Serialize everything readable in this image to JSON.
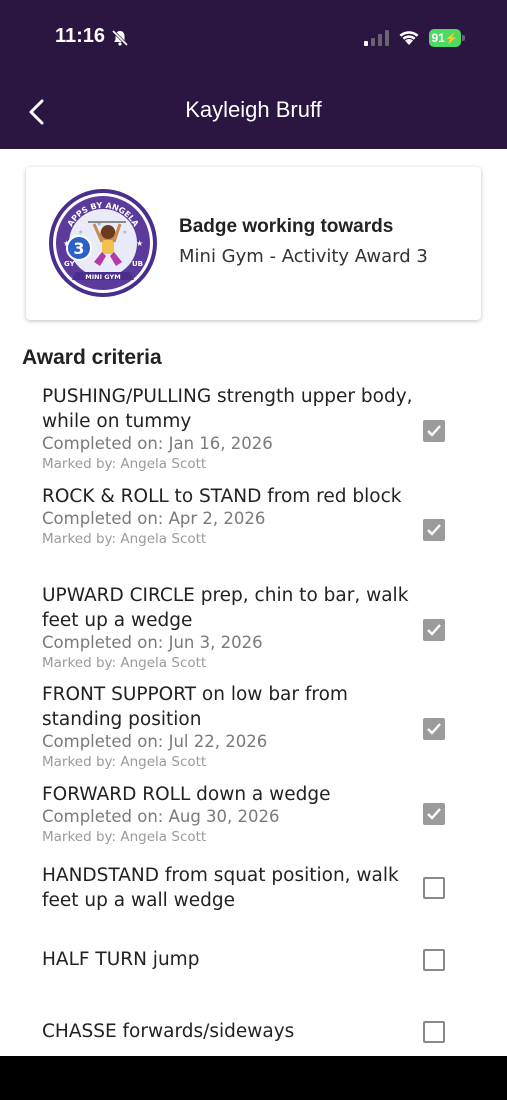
{
  "status": {
    "time": "11:16",
    "battery": "91"
  },
  "nav": {
    "title": "Kayleigh Bruff"
  },
  "badge_card": {
    "title": "Badge working towards",
    "subtitle": "Mini Gym - Activity Award 3",
    "logo": {
      "top_text": "APPS BY ANGELA",
      "bottom_text": "MINI GYM",
      "left_text": "GY",
      "right_text": "UB",
      "number": "3",
      "colors": {
        "ring": "#5b3a9c",
        "inner": "#e9ecf8",
        "ribbon": "#4a2d8c"
      }
    }
  },
  "criteria": {
    "heading": "Award criteria",
    "items": [
      {
        "title": "PUSHING/PULLING strength upper body, while on tummy",
        "completed": "Completed on: Jan 16, 2026",
        "marked": "Marked by: Angela Scott",
        "checked": true
      },
      {
        "title": "ROCK & ROLL to STAND from red block",
        "completed": "Completed on: Apr 2, 2026",
        "marked": "Marked by: Angela Scott",
        "checked": true
      },
      {
        "title": "UPWARD CIRCLE prep, chin to bar, walk feet up a wedge",
        "completed": "Completed on: Jun 3, 2026",
        "marked": "Marked by: Angela Scott",
        "checked": true
      },
      {
        "title": "FRONT SUPPORT on low bar from standing position",
        "completed": "Completed on: Jul 22, 2026",
        "marked": "Marked by: Angela Scott",
        "checked": true
      },
      {
        "title": "FORWARD ROLL down a wedge",
        "completed": "Completed on: Aug 30, 2026",
        "marked": "Marked by: Angela Scott",
        "checked": true
      },
      {
        "title": "HANDSTAND from squat position, walk feet up a wall wedge",
        "checked": false
      },
      {
        "title": "HALF TURN jump",
        "checked": false
      },
      {
        "title": "CHASSE forwards/sideways",
        "checked": false
      }
    ]
  },
  "colors": {
    "header": "#2a1640",
    "checked": "#9b9b9b",
    "battery": "#4cd964"
  }
}
